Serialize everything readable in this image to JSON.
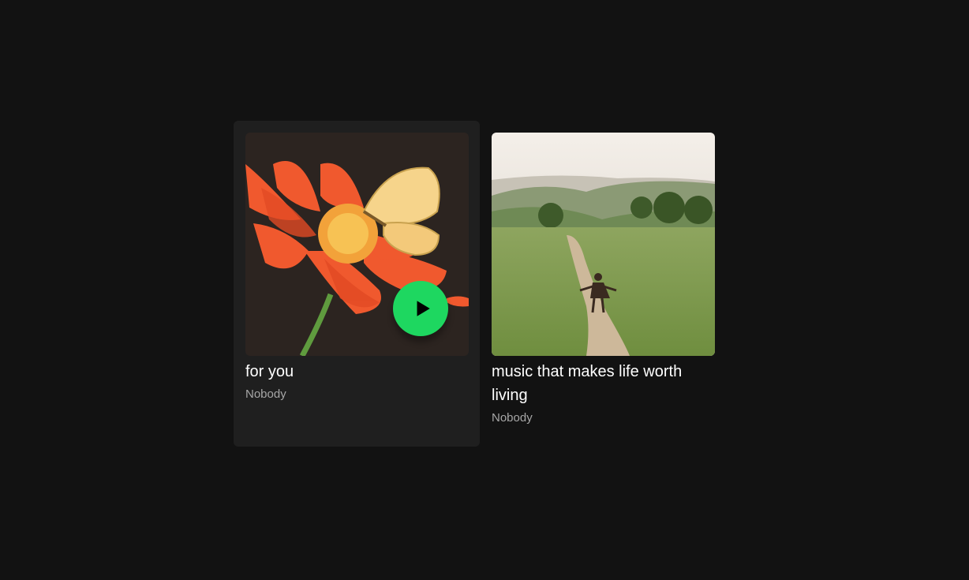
{
  "cards": [
    {
      "title": "for you",
      "subtitle": "Nobody",
      "cover_icon": "flower-butterfly-artwork",
      "hovered": true,
      "play_icon": "play-icon",
      "accent": "#1ed760"
    },
    {
      "title": "music that makes life worth living",
      "subtitle": "Nobody",
      "cover_icon": "meadow-path-photo",
      "hovered": false
    }
  ],
  "colors": {
    "background": "#121212",
    "card_hover": "#1f1f1f",
    "text_primary": "#ffffff",
    "text_secondary": "#a7a7a7"
  }
}
